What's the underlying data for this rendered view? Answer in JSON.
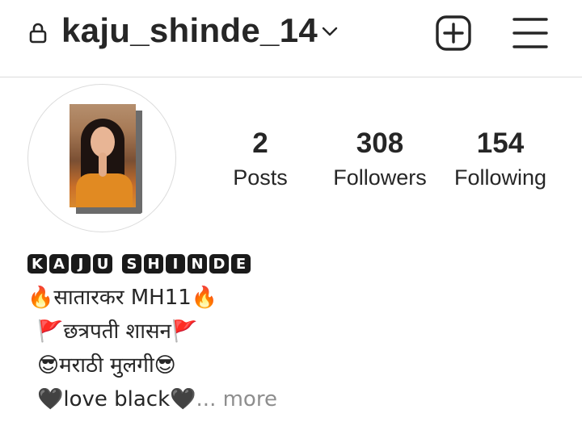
{
  "header": {
    "username": "kaju_shinde_14",
    "lock_icon": "lock-icon",
    "dropdown_icon": "chevron-down-icon",
    "new_post_icon": "plus-square-icon",
    "menu_icon": "hamburger-menu-icon"
  },
  "profile": {
    "avatar": "profile-photo",
    "stats": [
      {
        "value": "2",
        "label": "Posts"
      },
      {
        "value": "308",
        "label": "Followers"
      },
      {
        "value": "154",
        "label": "Following"
      }
    ]
  },
  "bio": {
    "display_name_letters": [
      "K",
      "A",
      "J",
      "U",
      "S",
      "H",
      "I",
      "N",
      "D",
      "E"
    ],
    "lines": [
      "🔥सातारकर MH11🔥",
      "🚩छत्रपती शासन🚩",
      "😎मराठी मुलगी😎",
      "🖤love black🖤"
    ],
    "more_label": "... more"
  },
  "colors": {
    "text": "#262626",
    "secondary": "#8e8e8e",
    "divider": "#dbdbdb"
  }
}
